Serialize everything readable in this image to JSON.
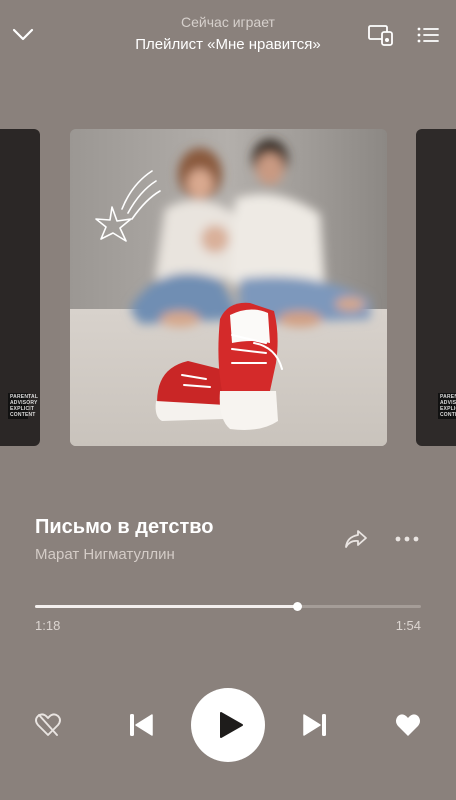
{
  "header": {
    "subtitle": "Сейчас играет",
    "title": "Плейлист «Мне нравится»",
    "collapse_icon": "chevron-down-icon",
    "devices_icon": "devices-icon",
    "queue_icon": "queue-list-icon"
  },
  "carousel": {
    "previous_cover_label": "PARENTAL ADVISORY EXPLICIT CONTENT",
    "next_cover_label": "PARENTAL ADVISORY EXPLICIT CONTENT"
  },
  "track": {
    "title": "Письмо в детство",
    "artist": "Марат Нигматуллин",
    "share_icon": "share-icon",
    "more_icon": "more-dots-icon"
  },
  "progress": {
    "elapsed": "1:18",
    "total": "1:54",
    "fraction": 0.68
  },
  "controls": {
    "dislike_icon": "dislike-heart-icon",
    "prev_icon": "skip-previous-icon",
    "play_icon": "play-icon",
    "next_icon": "skip-next-icon",
    "like_icon": "heart-filled-icon"
  },
  "colors": {
    "background": "#8a817c",
    "accent": "#ffffff",
    "secondary_text": "#d4ccc7",
    "sneaker_red": "#d42a2a"
  }
}
